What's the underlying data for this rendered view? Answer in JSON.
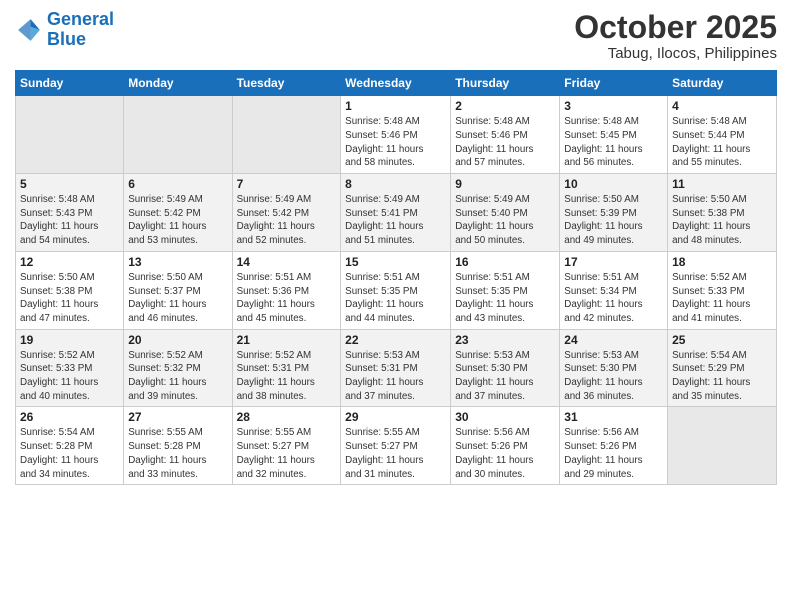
{
  "logo": {
    "line1": "General",
    "line2": "Blue"
  },
  "calendar": {
    "title": "October 2025",
    "subtitle": "Tabug, Ilocos, Philippines",
    "days_of_week": [
      "Sunday",
      "Monday",
      "Tuesday",
      "Wednesday",
      "Thursday",
      "Friday",
      "Saturday"
    ],
    "weeks": [
      [
        {
          "day": "",
          "info": ""
        },
        {
          "day": "",
          "info": ""
        },
        {
          "day": "",
          "info": ""
        },
        {
          "day": "1",
          "info": "Sunrise: 5:48 AM\nSunset: 5:46 PM\nDaylight: 11 hours\nand 58 minutes."
        },
        {
          "day": "2",
          "info": "Sunrise: 5:48 AM\nSunset: 5:46 PM\nDaylight: 11 hours\nand 57 minutes."
        },
        {
          "day": "3",
          "info": "Sunrise: 5:48 AM\nSunset: 5:45 PM\nDaylight: 11 hours\nand 56 minutes."
        },
        {
          "day": "4",
          "info": "Sunrise: 5:48 AM\nSunset: 5:44 PM\nDaylight: 11 hours\nand 55 minutes."
        }
      ],
      [
        {
          "day": "5",
          "info": "Sunrise: 5:48 AM\nSunset: 5:43 PM\nDaylight: 11 hours\nand 54 minutes."
        },
        {
          "day": "6",
          "info": "Sunrise: 5:49 AM\nSunset: 5:42 PM\nDaylight: 11 hours\nand 53 minutes."
        },
        {
          "day": "7",
          "info": "Sunrise: 5:49 AM\nSunset: 5:42 PM\nDaylight: 11 hours\nand 52 minutes."
        },
        {
          "day": "8",
          "info": "Sunrise: 5:49 AM\nSunset: 5:41 PM\nDaylight: 11 hours\nand 51 minutes."
        },
        {
          "day": "9",
          "info": "Sunrise: 5:49 AM\nSunset: 5:40 PM\nDaylight: 11 hours\nand 50 minutes."
        },
        {
          "day": "10",
          "info": "Sunrise: 5:50 AM\nSunset: 5:39 PM\nDaylight: 11 hours\nand 49 minutes."
        },
        {
          "day": "11",
          "info": "Sunrise: 5:50 AM\nSunset: 5:38 PM\nDaylight: 11 hours\nand 48 minutes."
        }
      ],
      [
        {
          "day": "12",
          "info": "Sunrise: 5:50 AM\nSunset: 5:38 PM\nDaylight: 11 hours\nand 47 minutes."
        },
        {
          "day": "13",
          "info": "Sunrise: 5:50 AM\nSunset: 5:37 PM\nDaylight: 11 hours\nand 46 minutes."
        },
        {
          "day": "14",
          "info": "Sunrise: 5:51 AM\nSunset: 5:36 PM\nDaylight: 11 hours\nand 45 minutes."
        },
        {
          "day": "15",
          "info": "Sunrise: 5:51 AM\nSunset: 5:35 PM\nDaylight: 11 hours\nand 44 minutes."
        },
        {
          "day": "16",
          "info": "Sunrise: 5:51 AM\nSunset: 5:35 PM\nDaylight: 11 hours\nand 43 minutes."
        },
        {
          "day": "17",
          "info": "Sunrise: 5:51 AM\nSunset: 5:34 PM\nDaylight: 11 hours\nand 42 minutes."
        },
        {
          "day": "18",
          "info": "Sunrise: 5:52 AM\nSunset: 5:33 PM\nDaylight: 11 hours\nand 41 minutes."
        }
      ],
      [
        {
          "day": "19",
          "info": "Sunrise: 5:52 AM\nSunset: 5:33 PM\nDaylight: 11 hours\nand 40 minutes."
        },
        {
          "day": "20",
          "info": "Sunrise: 5:52 AM\nSunset: 5:32 PM\nDaylight: 11 hours\nand 39 minutes."
        },
        {
          "day": "21",
          "info": "Sunrise: 5:52 AM\nSunset: 5:31 PM\nDaylight: 11 hours\nand 38 minutes."
        },
        {
          "day": "22",
          "info": "Sunrise: 5:53 AM\nSunset: 5:31 PM\nDaylight: 11 hours\nand 37 minutes."
        },
        {
          "day": "23",
          "info": "Sunrise: 5:53 AM\nSunset: 5:30 PM\nDaylight: 11 hours\nand 37 minutes."
        },
        {
          "day": "24",
          "info": "Sunrise: 5:53 AM\nSunset: 5:30 PM\nDaylight: 11 hours\nand 36 minutes."
        },
        {
          "day": "25",
          "info": "Sunrise: 5:54 AM\nSunset: 5:29 PM\nDaylight: 11 hours\nand 35 minutes."
        }
      ],
      [
        {
          "day": "26",
          "info": "Sunrise: 5:54 AM\nSunset: 5:28 PM\nDaylight: 11 hours\nand 34 minutes."
        },
        {
          "day": "27",
          "info": "Sunrise: 5:55 AM\nSunset: 5:28 PM\nDaylight: 11 hours\nand 33 minutes."
        },
        {
          "day": "28",
          "info": "Sunrise: 5:55 AM\nSunset: 5:27 PM\nDaylight: 11 hours\nand 32 minutes."
        },
        {
          "day": "29",
          "info": "Sunrise: 5:55 AM\nSunset: 5:27 PM\nDaylight: 11 hours\nand 31 minutes."
        },
        {
          "day": "30",
          "info": "Sunrise: 5:56 AM\nSunset: 5:26 PM\nDaylight: 11 hours\nand 30 minutes."
        },
        {
          "day": "31",
          "info": "Sunrise: 5:56 AM\nSunset: 5:26 PM\nDaylight: 11 hours\nand 29 minutes."
        },
        {
          "day": "",
          "info": ""
        }
      ]
    ]
  }
}
